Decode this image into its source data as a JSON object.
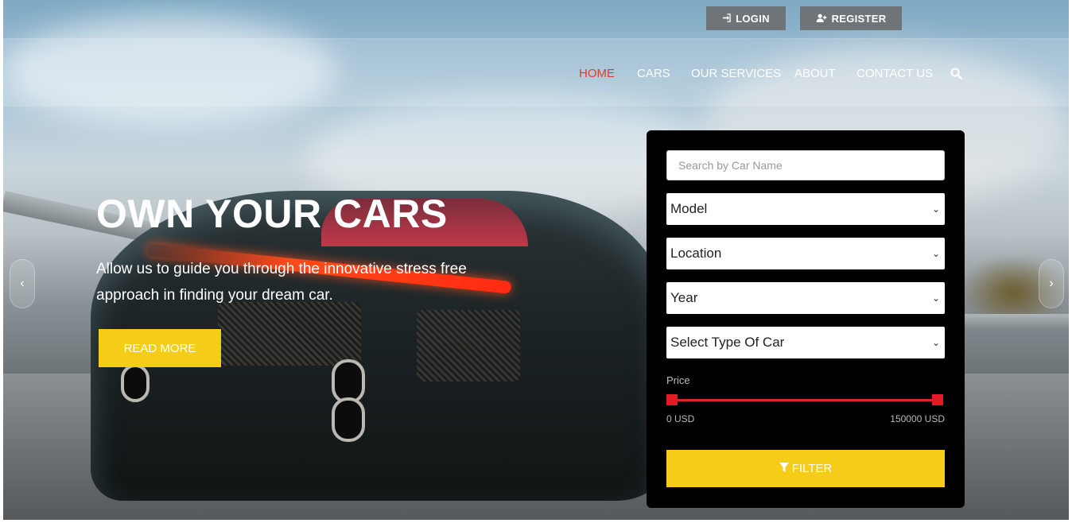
{
  "topbar": {
    "login": {
      "icon": "sign-in-icon",
      "label": "LOGIN"
    },
    "register": {
      "icon": "user-plus-icon",
      "label": "REGISTER"
    }
  },
  "nav": {
    "items": [
      {
        "label": "HOME",
        "active": true
      },
      {
        "label": "CARS",
        "active": false
      },
      {
        "label": "OUR SERVICES",
        "active": false
      },
      {
        "label": "ABOUT",
        "active": false
      },
      {
        "label": "CONTACT US",
        "active": false
      }
    ],
    "search_icon": "search-icon",
    "active_color": "#e23b2e"
  },
  "hero": {
    "title": "OWN YOUR CARS",
    "text": "Allow us to guide you through the innovative stress free approach in finding your dream car.",
    "button_label": "READ MORE",
    "prev_icon": "chevron-left-icon",
    "next_icon": "chevron-right-icon"
  },
  "filter": {
    "search_placeholder": "Search by Car Name",
    "selects": [
      {
        "value": "Model"
      },
      {
        "value": "Location"
      },
      {
        "value": "Year"
      },
      {
        "value": "Select Type Of Car"
      }
    ],
    "price_label": "Price",
    "price_min": "0 USD",
    "price_max": "150000 USD",
    "price_range": {
      "min": 0,
      "max": 150000,
      "low": 0,
      "high": 150000
    },
    "button_icon": "filter-icon",
    "button_label": "FILTER"
  },
  "colors": {
    "accent_yellow": "#f5cc17",
    "range_red": "#e01b24",
    "panel_bg": "#000000"
  }
}
